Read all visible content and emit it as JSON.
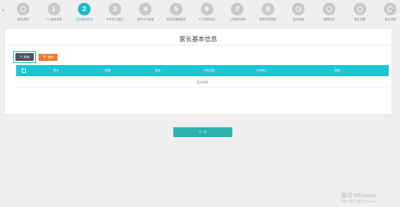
{
  "stepper": {
    "steps": [
      {
        "kind": "icon",
        "icon": "circle-icon",
        "label": "报告须知",
        "state": "done"
      },
      {
        "kind": "number",
        "number": "1",
        "label": "个人基本信息",
        "state": "done"
      },
      {
        "kind": "number",
        "number": "2",
        "label": "家长基本信息",
        "state": "active"
      },
      {
        "kind": "number",
        "number": "3",
        "label": "中学学习经历",
        "state": "todo"
      },
      {
        "kind": "number",
        "number": "4",
        "label": "高中学习成绩",
        "state": "todo"
      },
      {
        "kind": "number",
        "number": "5",
        "label": "奖惩及兼职获奖",
        "state": "todo"
      },
      {
        "kind": "number",
        "number": "6",
        "label": "个人获奖经历",
        "state": "todo"
      },
      {
        "kind": "number",
        "number": "7",
        "label": "上传报名材料",
        "state": "todo"
      },
      {
        "kind": "number",
        "number": "8",
        "label": "报考信息预览",
        "state": "todo"
      },
      {
        "kind": "icon",
        "icon": "circle-icon",
        "label": "报名进度",
        "state": "todo"
      },
      {
        "kind": "icon",
        "icon": "circle-icon",
        "label": "缴费信息",
        "state": "todo"
      },
      {
        "kind": "icon",
        "icon": "circle-icon",
        "label": "常见问题",
        "state": "todo"
      },
      {
        "kind": "icon",
        "icon": "circle-icon",
        "label": "报名须知",
        "state": "todo"
      }
    ],
    "prev_arrow": "‹",
    "next_arrow": "›"
  },
  "main": {
    "title": "家长基本信息",
    "add_button": {
      "glyph": "+",
      "label": "新增"
    },
    "delete_button": {
      "glyph": "✕",
      "label": "删除"
    },
    "table": {
      "columns": [
        "姓名",
        "称谓",
        "关系",
        "手机号码",
        "工作单位",
        "职务"
      ],
      "empty_text": "暂无数据"
    },
    "next_button": "下一步"
  },
  "watermark": {
    "title": "激活 Windows",
    "subtitle": "转到\"设置\"以激活 Windows。"
  },
  "colors": {
    "accent": "#1bb9c4",
    "table_header": "#1cc6d4",
    "next_button": "#2ab3b0",
    "delete_button": "#f47b29",
    "add_button": "#4a5561"
  }
}
